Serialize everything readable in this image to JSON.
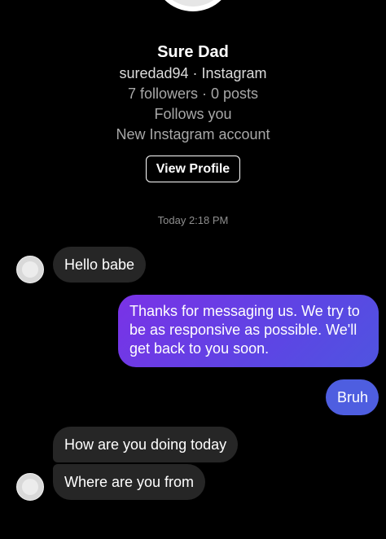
{
  "profile": {
    "name": "Sure Dad",
    "handle": "suredad94 · Instagram",
    "stats": "7 followers · 0 posts",
    "follows": "Follows you",
    "note": "New Instagram account",
    "view_profile_label": "View Profile"
  },
  "thread": {
    "timestamp": "Today 2:18 PM",
    "messages": [
      {
        "direction": "incoming",
        "text": "Hello babe"
      },
      {
        "direction": "outgoing",
        "text": "Thanks for messaging us. We try to be as responsive as possible. We'll get back to you soon."
      },
      {
        "direction": "outgoing",
        "text": "Bruh"
      },
      {
        "direction": "incoming",
        "text": "How are you doing today"
      },
      {
        "direction": "incoming",
        "text": "Where are you from"
      }
    ]
  },
  "colors": {
    "background": "#000000",
    "incoming_bubble": "#262626",
    "outgoing_gradient_start": "#7a32e6",
    "outgoing_gradient_end": "#4f54e0",
    "outgoing_solid": "#4e5ee0",
    "muted_text": "#a8a8a8"
  }
}
